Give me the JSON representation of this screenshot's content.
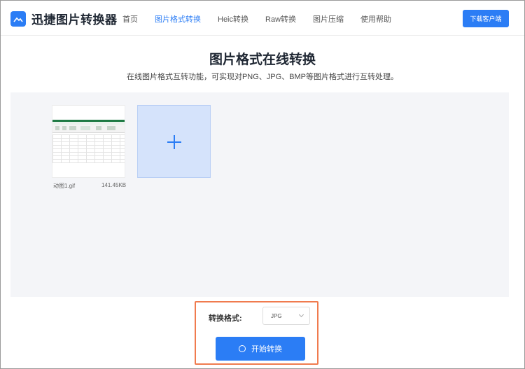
{
  "header": {
    "logo_text": "迅捷图片转换器",
    "nav": [
      {
        "label": "首页",
        "active": false
      },
      {
        "label": "图片格式转换",
        "active": true
      },
      {
        "label": "Heic转换",
        "active": false
      },
      {
        "label": "Raw转换",
        "active": false
      },
      {
        "label": "图片压缩",
        "active": false
      },
      {
        "label": "使用帮助",
        "active": false
      }
    ],
    "download_label": "下载客户端"
  },
  "main": {
    "title": "图片格式在线转换",
    "subtitle": "在线图片格式互转功能，可实现对PNG、JPG、BMP等图片格式进行互转处理。"
  },
  "upload": {
    "file": {
      "name": "动图1.gif",
      "size": "141.45KB"
    },
    "add_icon": "plus-icon"
  },
  "controls": {
    "format_label": "转换格式:",
    "format_value": "JPG",
    "start_label": "开始转换"
  },
  "colors": {
    "accent": "#2b7df5",
    "highlight_border": "#f07b4e",
    "upload_bg": "#f4f5f8"
  }
}
